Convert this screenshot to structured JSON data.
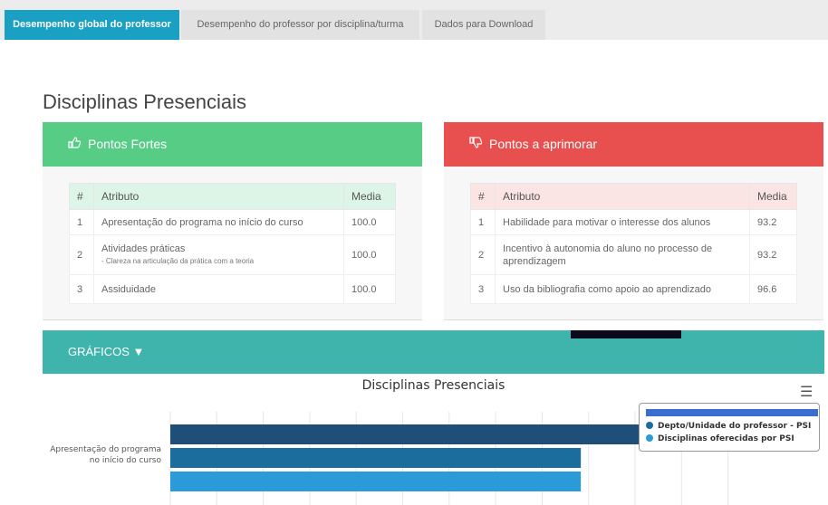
{
  "tabs": [
    {
      "label": "Desempenho global do professor",
      "active": true
    },
    {
      "label": "Desempenho do professor por disciplina/turma",
      "active": false
    },
    {
      "label": "Dados para Download",
      "active": false
    }
  ],
  "page_title": "Disciplinas Presenciais",
  "strengths": {
    "title": "Pontos Fortes",
    "icon": "thumbs-up-icon",
    "headers": [
      "#",
      "Atributo",
      "Media"
    ],
    "rows": [
      {
        "n": "1",
        "attr": "Apresentação do programa no início do curso",
        "sub": "",
        "media": "100.0"
      },
      {
        "n": "2",
        "attr": "Atividades práticas",
        "sub": "- Clareza na articulação da prática com a teoria",
        "media": "100.0"
      },
      {
        "n": "3",
        "attr": "Assiduidade",
        "sub": "",
        "media": "100.0"
      }
    ]
  },
  "improve": {
    "title": "Pontos a aprimorar",
    "icon": "thumbs-down-icon",
    "headers": [
      "#",
      "Atributo",
      "Media"
    ],
    "rows": [
      {
        "n": "1",
        "attr": "Habilidade para motivar o interesse dos alunos",
        "media": "93.2"
      },
      {
        "n": "2",
        "attr": "Incentivo à autonomia do aluno no processo de aprendizagem",
        "media": "93.2"
      },
      {
        "n": "3",
        "attr": "Uso da bibliografia como apoio ao aprendizado",
        "media": "96.6"
      }
    ]
  },
  "graficos": {
    "label": "GRÁFICOS ▼"
  },
  "chart_data": {
    "type": "bar",
    "orientation": "horizontal",
    "title": "Disciplinas Presenciais",
    "categories": [
      "Apresentação do programa no início do curso"
    ],
    "series": [
      {
        "name": "",
        "color": "#1f4e79",
        "values": [
          100.0
        ]
      },
      {
        "name": "Depto/Unidade do professor - PSI",
        "color": "#1a6d9c",
        "values": [
          85.5
        ]
      },
      {
        "name": "Disciplinas oferecidas por PSI",
        "color": "#2a9ad8",
        "values": [
          85.5
        ]
      }
    ]
  },
  "colors": {
    "accent_tab": "#1aa0c2",
    "strength": "#56cc85",
    "improve": "#e85050",
    "graficos": "#3fb4ad"
  }
}
